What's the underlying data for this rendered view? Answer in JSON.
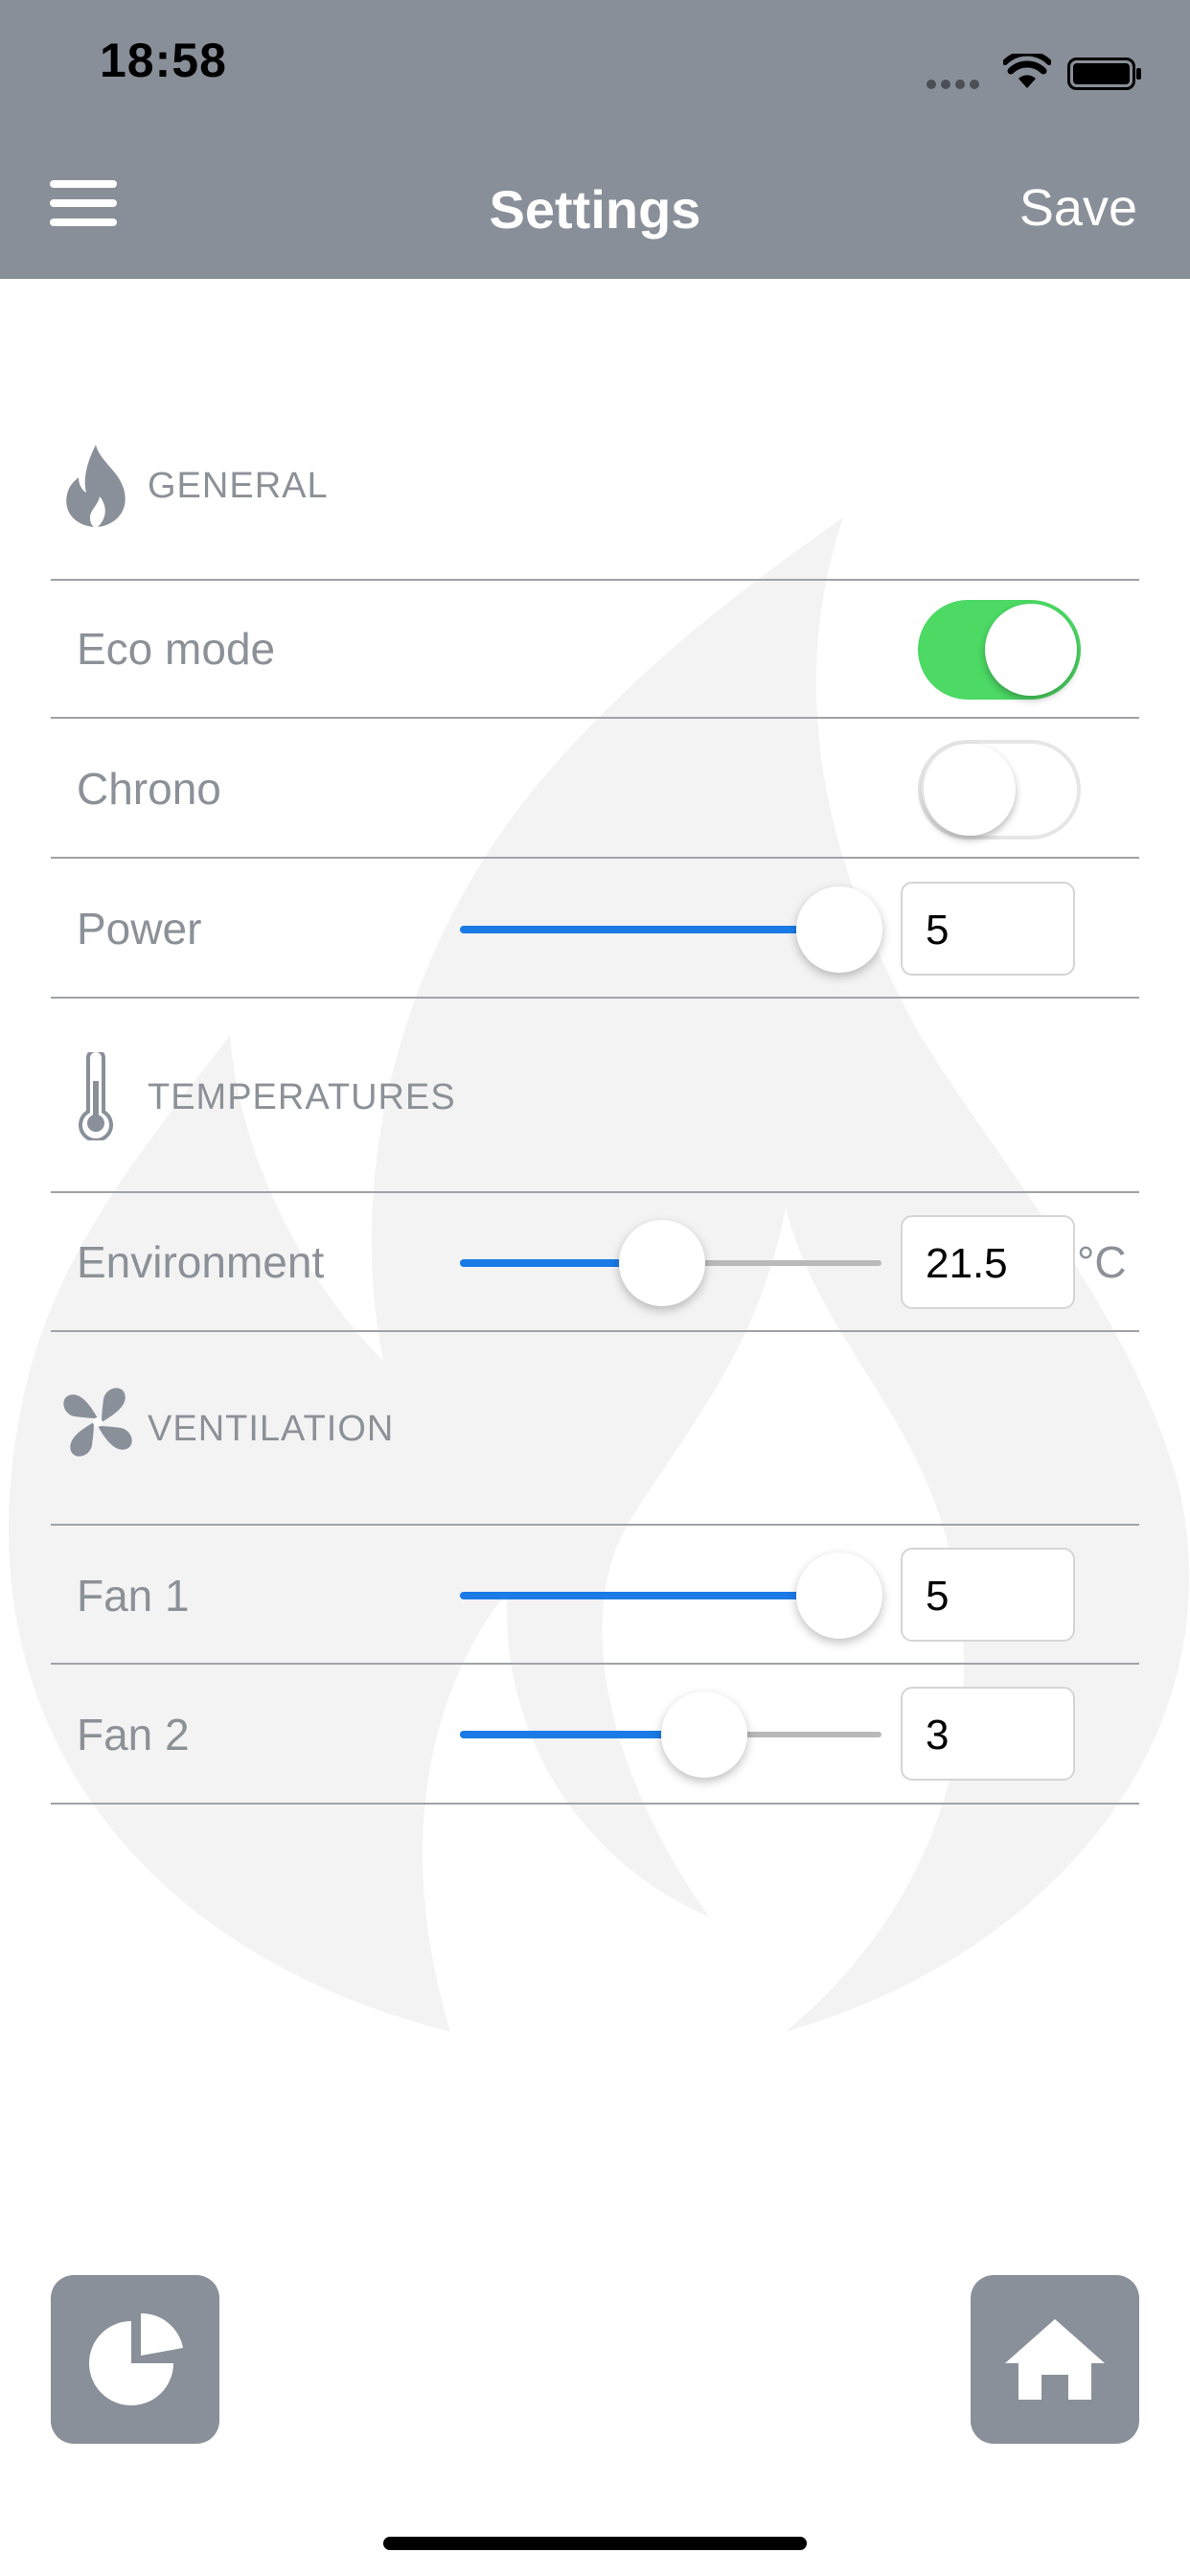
{
  "status_bar": {
    "time": "18:58"
  },
  "nav": {
    "title": "Settings",
    "save_label": "Save"
  },
  "sections": {
    "general": {
      "title": "GENERAL",
      "eco_mode": {
        "label": "Eco mode",
        "on": true
      },
      "chrono": {
        "label": "Chrono",
        "on": false
      },
      "power": {
        "label": "Power",
        "value": "5",
        "level_percent": 90
      }
    },
    "temperatures": {
      "title": "TEMPERATURES",
      "environment": {
        "label": "Environment",
        "value": "21.5",
        "unit": "°C",
        "level_percent": 48
      }
    },
    "ventilation": {
      "title": "VENTILATION",
      "fan1": {
        "label": "Fan 1",
        "value": "5",
        "level_percent": 90
      },
      "fan2": {
        "label": "Fan 2",
        "value": "3",
        "level_percent": 58
      }
    }
  },
  "colors": {
    "header": "#898f98",
    "accent": "#1a7ae6",
    "toggle_on": "#4cd964",
    "text_muted": "#8c9198"
  },
  "icons": {
    "menu": "hamburger-icon",
    "general": "flame-icon",
    "temperatures": "thermometer-icon",
    "ventilation": "fan-icon",
    "bottom_left": "pie-chart-icon",
    "bottom_right": "home-icon"
  }
}
